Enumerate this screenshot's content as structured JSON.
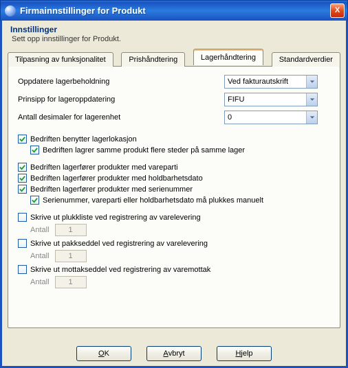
{
  "window": {
    "title": "Firmainnstillinger for Produkt",
    "close_glyph": "X"
  },
  "heading": {
    "title": "Innstillinger",
    "subtitle": "Sett opp innstillinger for Produkt."
  },
  "tabs": [
    {
      "label": "Tilpasning av funksjonalitet"
    },
    {
      "label": "Prishåndtering"
    },
    {
      "label": "Lagerhåndtering"
    },
    {
      "label": "Standardverdier"
    }
  ],
  "activeTab": 2,
  "settings": {
    "updateStock": {
      "label": "Oppdatere lagerbeholdning",
      "value": "Ved fakturautskrift"
    },
    "updatePrinciple": {
      "label": "Prinsipp for lageroppdatering",
      "value": "FIFU"
    },
    "decimals": {
      "label": "Antall desimaler for lagerenhet",
      "value": "0"
    }
  },
  "checks": {
    "usesLocation": {
      "label": "Bedriften benytter lagerlokasjon",
      "checked": true
    },
    "sameProductMultiPlaces": {
      "label": "Bedriften lagrer samme produkt flere steder på samme lager",
      "checked": true
    },
    "batch": {
      "label": "Bedriften lagerfører produkter med vareparti",
      "checked": true
    },
    "expiry": {
      "label": "Bedriften lagerfører produkter med holdbarhetsdato",
      "checked": true
    },
    "serial": {
      "label": "Bedriften lagerfører produkter med serienummer",
      "checked": true
    },
    "manualPick": {
      "label": "Serienummer, vareparti eller holdbarhetsdato må plukkes manuelt",
      "checked": true
    },
    "printPick": {
      "label": "Skrive ut plukkliste ved registrering av varelevering",
      "checked": false
    },
    "printPack": {
      "label": "Skrive ut pakkseddel ved registrering av varelevering",
      "checked": false
    },
    "printRecv": {
      "label": "Skrive ut mottakseddel ved registrering av varemottak",
      "checked": false
    }
  },
  "qty": {
    "label": "Antall",
    "pick": "1",
    "pack": "1",
    "recv": "1"
  },
  "footer": {
    "ok": {
      "accel": "O",
      "rest": "K"
    },
    "cancel": {
      "accel": "A",
      "rest": "vbryt"
    },
    "help": {
      "accel": "H",
      "rest": "jelp"
    }
  }
}
